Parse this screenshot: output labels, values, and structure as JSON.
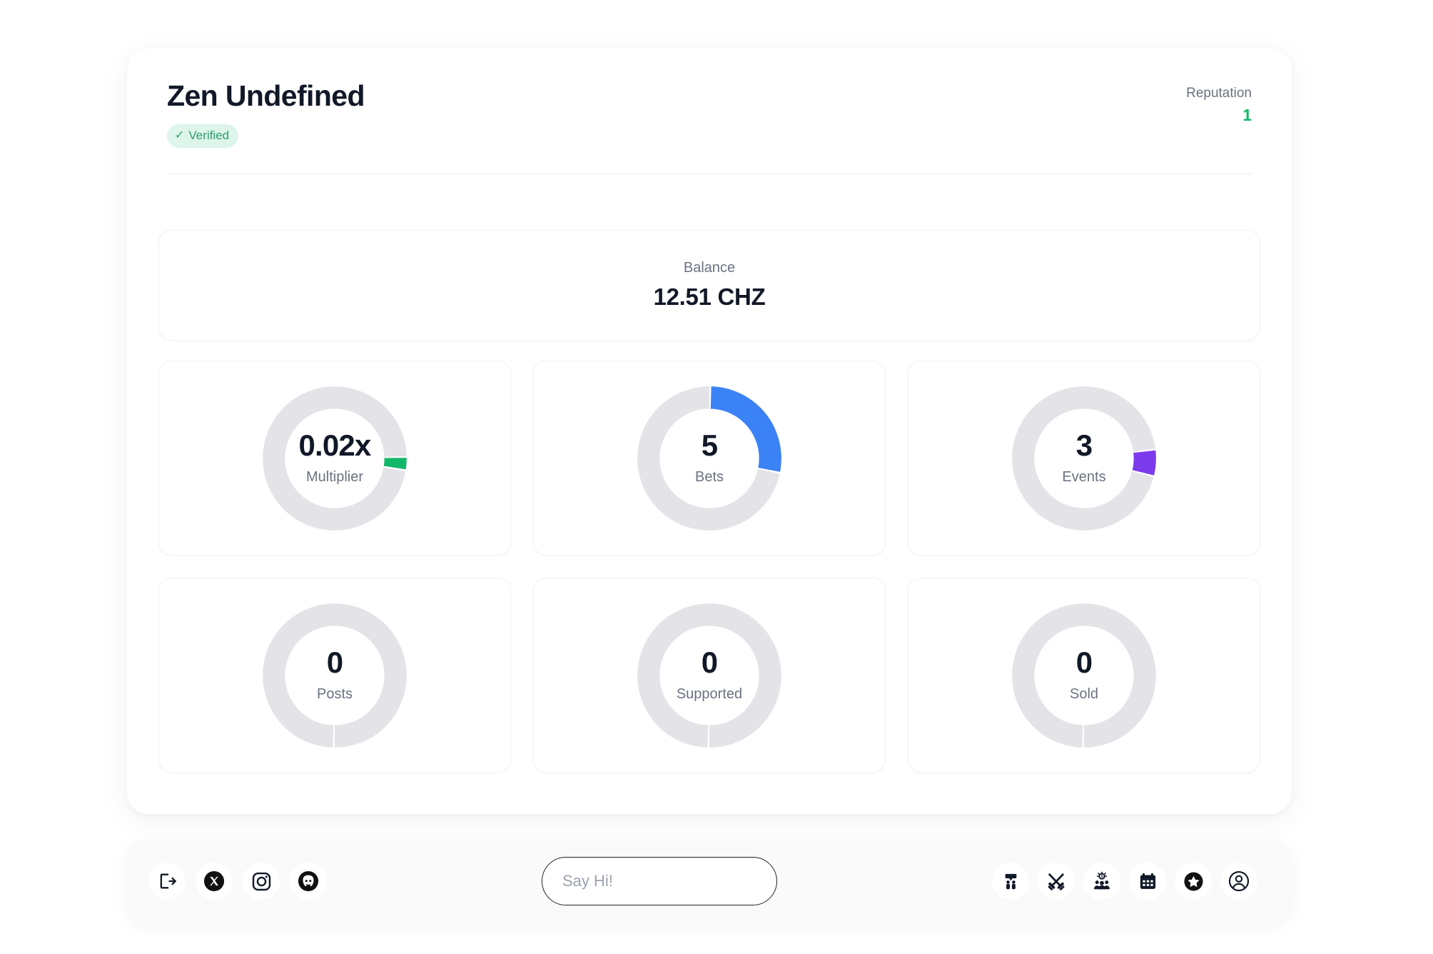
{
  "profile": {
    "name": "Zen Undefined",
    "verified_label": "Verified",
    "verified_tick": "✓",
    "reputation_label": "Reputation",
    "reputation_value": "1"
  },
  "balance": {
    "label": "Balance",
    "value": "12.51 CHZ"
  },
  "colors": {
    "accent_green": "#12b76a",
    "accent_blue": "#3b82f6",
    "accent_purple": "#7c3aed",
    "track_gray": "#e4e4e8",
    "text_dark": "#111827",
    "text_muted": "#6b7280",
    "badge_bg": "#ddf5ea"
  },
  "chart_data": [
    {
      "type": "pie",
      "title": "Multiplier",
      "value_label": "0.02x",
      "value": 0.02,
      "percent": 3,
      "arc_color": "#12b76a",
      "track_color": "#e4e4e8",
      "start_angle_deg": 88
    },
    {
      "type": "pie",
      "title": "Bets",
      "value_label": "5",
      "value": 5,
      "percent": 28,
      "arc_color": "#3b82f6",
      "track_color": "#e4e4e8",
      "start_angle_deg": 0
    },
    {
      "type": "pie",
      "title": "Events",
      "value_label": "3",
      "value": 3,
      "percent": 6,
      "arc_color": "#7c3aed",
      "track_color": "#e4e4e8",
      "start_angle_deg": 82
    },
    {
      "type": "pie",
      "title": "Posts",
      "value_label": "0",
      "value": 0,
      "percent": 0,
      "arc_color": "#e4e4e8",
      "track_color": "#e4e4e8",
      "start_angle_deg": 90
    },
    {
      "type": "pie",
      "title": "Supported",
      "value_label": "0",
      "value": 0,
      "percent": 0,
      "arc_color": "#e4e4e8",
      "track_color": "#e4e4e8",
      "start_angle_deg": 90
    },
    {
      "type": "pie",
      "title": "Sold",
      "value_label": "0",
      "value": 0,
      "percent": 0,
      "arc_color": "#e4e4e8",
      "track_color": "#e4e4e8",
      "start_angle_deg": 90
    }
  ],
  "stats": [
    {
      "value": "0.02x",
      "label": "Multiplier"
    },
    {
      "value": "5",
      "label": "Bets"
    },
    {
      "value": "3",
      "label": "Events"
    },
    {
      "value": "0",
      "label": "Posts"
    },
    {
      "value": "0",
      "label": "Supported"
    },
    {
      "value": "0",
      "label": "Sold"
    }
  ],
  "bottom_bar": {
    "left_icons": [
      {
        "name": "logout-icon"
      },
      {
        "name": "x-twitter-icon"
      },
      {
        "name": "instagram-icon"
      },
      {
        "name": "discord-icon"
      }
    ],
    "chat_input": {
      "placeholder": "Say Hi!",
      "value": ""
    },
    "right_icons": [
      {
        "name": "community-chat-icon"
      },
      {
        "name": "crossed-swords-icon"
      },
      {
        "name": "crowdfunding-icon"
      },
      {
        "name": "calendar-icon"
      },
      {
        "name": "star-icon"
      },
      {
        "name": "user-profile-icon"
      }
    ]
  }
}
